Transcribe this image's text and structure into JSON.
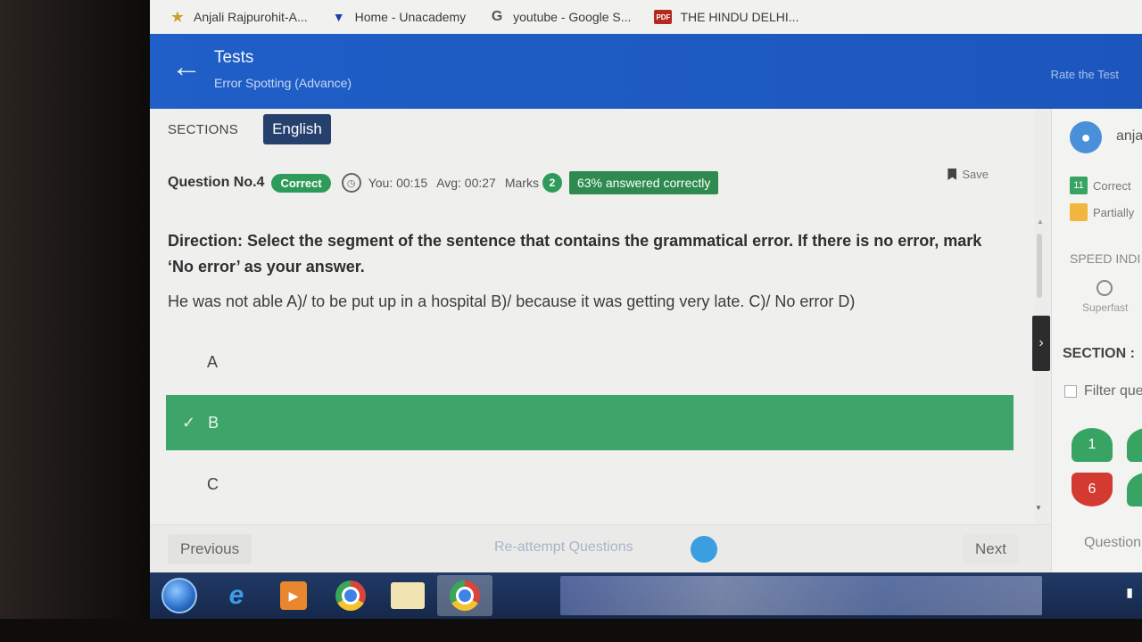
{
  "bookmarks": [
    {
      "label": "Anjali Rajpurohit-A...",
      "icon": "star-icon"
    },
    {
      "label": "Home - Unacademy",
      "icon": "unacademy-icon"
    },
    {
      "label": "youtube - Google S...",
      "icon": "google-icon"
    },
    {
      "label": "THE HINDU DELHI...",
      "icon": "pdf-icon"
    }
  ],
  "header": {
    "title": "Tests",
    "subtitle": "Error Spotting (Advance)",
    "rate_label": "Rate the Test"
  },
  "sections": {
    "label": "SECTIONS",
    "active": "English"
  },
  "question": {
    "number_label": "Question No.4",
    "status": "Correct",
    "you_time": "You: 00:15",
    "avg_time": "Avg: 00:27",
    "marks_label": "Marks",
    "marks_value": "2",
    "answered_correctly": "63% answered correctly",
    "save_label": "Save",
    "direction": "Direction: Select the segment of the sentence that contains the grammatical error. If there is no error, mark ‘No error’ as your answer.",
    "sentence": "He was not able A)/ to be put up in a hospital B)/ because it was getting very late. C)/ No error D)"
  },
  "options": [
    {
      "label": "A",
      "selected": false
    },
    {
      "label": "B",
      "selected": true
    },
    {
      "label": "C",
      "selected": false
    }
  ],
  "footer": {
    "previous": "Previous",
    "reattempt": "Re-attempt Questions",
    "next": "Next"
  },
  "sidebar": {
    "user_name": "anja",
    "correct_count": "11",
    "correct_label": "Correct",
    "partial_label": "Partially",
    "speed_label": "SPEED INDI",
    "speed_value": "Superfast",
    "section_label": "SECTION :",
    "filter_label": "Filter que",
    "question_bubbles": [
      {
        "number": "1",
        "status": "correct"
      },
      {
        "number": "6",
        "status": "incorrect"
      }
    ],
    "footer_label": "Question"
  },
  "colors": {
    "header_blue": "#1f5fc7",
    "correct_green": "#2e9b5a",
    "selected_option": "#3da56a",
    "section_active": "#26406d",
    "incorrect_red": "#d23a32"
  }
}
